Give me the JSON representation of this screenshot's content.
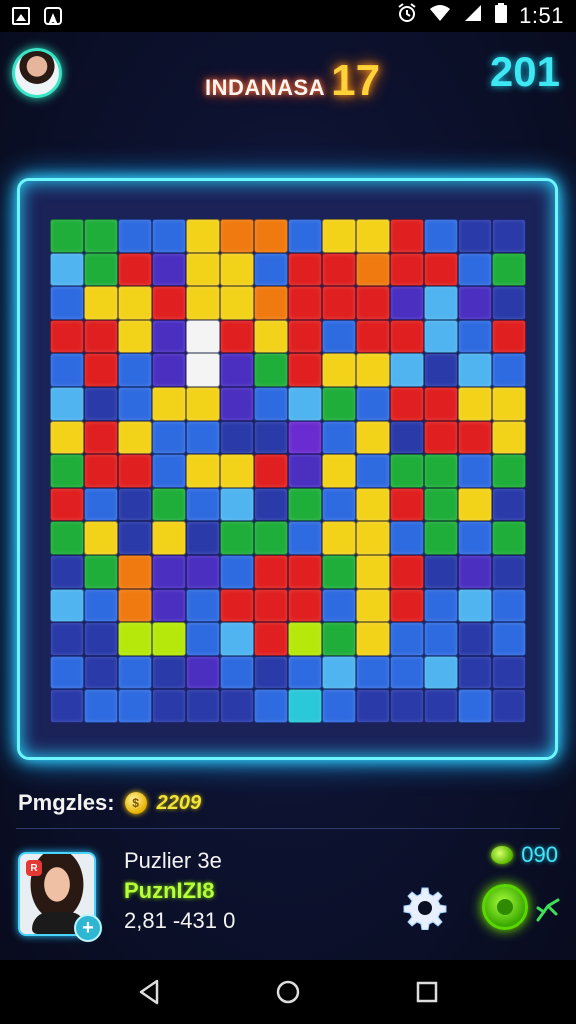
{
  "status_bar": {
    "time": "1:51",
    "left_icons": [
      "gallery-icon",
      "navigation-icon"
    ],
    "right_icons": [
      "alarm-icon",
      "wifi-icon",
      "signal-icon",
      "battery-icon"
    ]
  },
  "header": {
    "title": "INDANASA",
    "level": "17",
    "score": "201"
  },
  "board": {
    "columns": 14,
    "rows": 15,
    "colors": {
      "G": "#1fae3a",
      "B": "#2f6be0",
      "P": "#4a2fc0",
      "R": "#e02020",
      "Y": "#f3d21a",
      "O": "#f07a10",
      "L": "#4fb4f0",
      "W": "#f4f4f4",
      "N": "#2a3aa8",
      "V": "#6a2cd0",
      "C": "#2ac8d8",
      "K": "#b6e80c"
    },
    "grid": [
      "GGBBYOOBYYRBNN",
      "LGRPYYBRRORRBG",
      "BYYRYYORRRPLPN",
      "RRYPWRYRBRRLBR",
      "BRBPWPGRYYLNLB",
      "LNBYYPBLGBRRYY",
      "YRYBBNNVBYNRRY",
      "GRRBYYRPYBGGBG",
      "RBNGBLNGBYRGYN",
      "GYNYNGGBYYBGBG",
      "NGOPPBRRGYRNPN",
      "LBOPBRRRBYRBLB",
      "NNKKBLRKGYBBNB",
      "BNBNPBNBLBBLNN",
      "NBBNNNBCBNNNBN"
    ]
  },
  "score_row": {
    "label": "Pmgzles:",
    "coin_symbol": "$",
    "value": "2209"
  },
  "player": {
    "name": "Puzlier 3e",
    "rank": "PuznIZI8",
    "stat": "2,81 -431 0",
    "badge": "R",
    "add_symbol": "+"
  },
  "gems": {
    "value": "090"
  },
  "bottom_actions": {
    "settings_icon": "gear-icon",
    "play_icon": "play-icon",
    "share_icon": "share-icon"
  },
  "nav": [
    "back-icon",
    "home-icon",
    "recents-icon"
  ]
}
